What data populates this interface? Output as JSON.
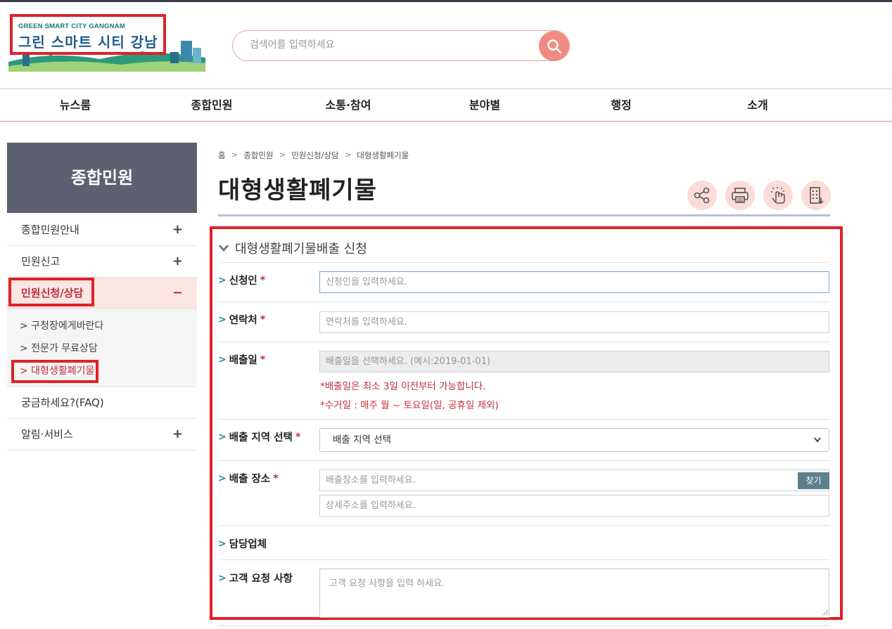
{
  "header": {
    "logo_sub": "GREEN SMART CITY GANGNAM",
    "logo_main": "그린 스마트 시티 강남",
    "search_placeholder": "검색어를 입력하세요",
    "accent_color": "#ef8c81"
  },
  "gnb": {
    "items": [
      "뉴스룸",
      "종합민원",
      "소통·참여",
      "분야별",
      "행정",
      "소개"
    ]
  },
  "sidebar": {
    "title": "종합민원",
    "items": [
      {
        "label": "종합민원안내",
        "icon": "+"
      },
      {
        "label": "민원신고",
        "icon": "+"
      },
      {
        "label": "민원신청/상담",
        "icon": "−"
      },
      {
        "label": "궁금하세요?(FAQ)",
        "icon": ""
      },
      {
        "label": "알림·서비스",
        "icon": "+"
      }
    ],
    "sub_items": [
      "> 구청장에게바란다",
      "> 전문가 무료상담",
      "> 대형생활폐기물"
    ]
  },
  "breadcrumb": [
    "홈",
    "종합민원",
    "민원신청/상담",
    "대형생활폐기물"
  ],
  "breadcrumb_sep": ">",
  "page_title": "대형생활폐기물",
  "tools": [
    "share-icon",
    "print-icon",
    "finger-icon",
    "building-icon"
  ],
  "form": {
    "section_title": "대형생활폐기물배출 신청",
    "applicant": {
      "label": "신청인",
      "required": "*",
      "placeholder": "신청인을 입력하세요."
    },
    "contact": {
      "label": "연락처",
      "required": "*",
      "placeholder": "연락처를 입력하세요."
    },
    "date": {
      "label": "배출일",
      "required": "*",
      "placeholder": "배출일을 선택하세요. (예시:2019-01-01)",
      "note1": "*배출일은 최소 3일 이전부터 가능합니다.",
      "note2": "*수거일 : 매주 월 ~ 토요일(일, 공휴일 제외)"
    },
    "region": {
      "label": "배출 지역 선택",
      "required": "*",
      "value": "배출 지역 선택"
    },
    "place": {
      "label": "배출 장소",
      "required": "*",
      "placeholder": "배출장소를 입력하세요.",
      "detail_placeholder": "상세주소를 입력하세요.",
      "find_label": "찾기"
    },
    "company": {
      "label": "담당업체"
    },
    "request": {
      "label": "고객 요청 사항",
      "placeholder": "고객 요청 사항을 입력 하세요."
    }
  }
}
